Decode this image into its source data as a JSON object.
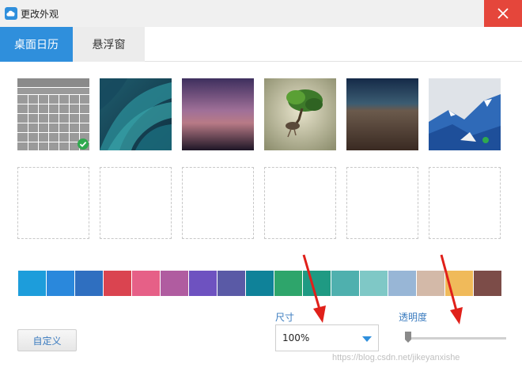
{
  "window": {
    "title": "更改外观",
    "app_icon": "cloud-calendar-icon",
    "close_icon": "close-icon"
  },
  "tabs": [
    {
      "label": "桌面日历",
      "active": true
    },
    {
      "label": "悬浮窗",
      "active": false
    }
  ],
  "backgrounds": [
    {
      "name": "calendar-grid",
      "selected": true
    },
    {
      "name": "teal-petals",
      "selected": false
    },
    {
      "name": "purple-dusk",
      "selected": false
    },
    {
      "name": "floating-tree",
      "selected": false
    },
    {
      "name": "brown-plain",
      "selected": false
    },
    {
      "name": "blue-mountains",
      "selected": false
    }
  ],
  "empty_slots": 6,
  "colors": [
    "#1d9ddb",
    "#2a88dc",
    "#2f6fc0",
    "#da4450",
    "#e66087",
    "#b05ca0",
    "#6e52c0",
    "#5a5aa6",
    "#0f8299",
    "#2ea56b",
    "#1f9a83",
    "#4fb0ae",
    "#7fc8c6",
    "#98b6d6",
    "#d3b9a8",
    "#f0ba5a",
    "#7c4c48"
  ],
  "custom_button": "自定义",
  "size": {
    "label": "尺寸",
    "value": "100%"
  },
  "opacity": {
    "label": "透明度",
    "level": 0.02
  },
  "watermark": "https://blog.csdn.net/jikeyanxishe",
  "accent": "#2f8fdc"
}
